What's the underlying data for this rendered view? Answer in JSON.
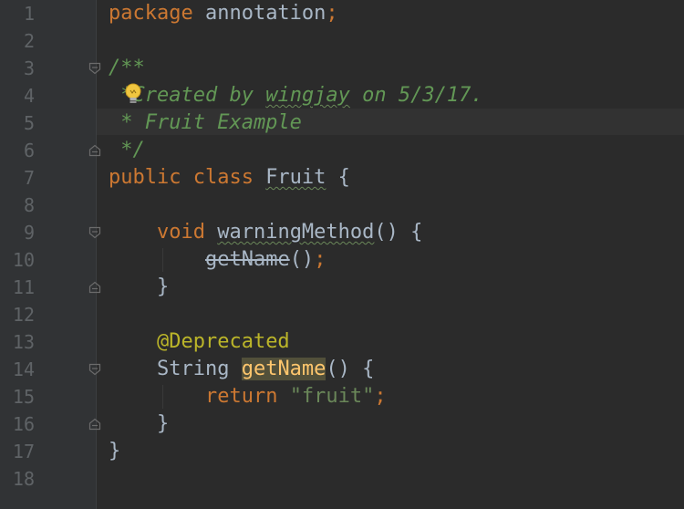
{
  "editor": {
    "line_numbers": [
      "1",
      "2",
      "3",
      "4",
      "5",
      "6",
      "7",
      "8",
      "9",
      "10",
      "11",
      "12",
      "13",
      "14",
      "15",
      "16",
      "17",
      "18"
    ],
    "line1": {
      "kw": "package",
      "rest": " annotation",
      "semi": ";"
    },
    "line3": {
      "doc": "/**"
    },
    "line4": {
      "star": "*",
      "pre": "Created by ",
      "author": "wingjay",
      "post": " on 5/3/17."
    },
    "line5": {
      "doc": " * Fruit Example"
    },
    "line6": {
      "doc": " */"
    },
    "line7": {
      "kw": "public class ",
      "classname": "Fruit",
      "rest": " {"
    },
    "line9": {
      "indent": "    ",
      "kw": "void ",
      "method": "warningMethod",
      "rest": "() {"
    },
    "line10": {
      "indent": "        ",
      "call": "getName",
      "parens": "()",
      "semi": ";"
    },
    "line11": {
      "code": "    }"
    },
    "line13": {
      "indent": "    ",
      "annotation": "@Deprecated"
    },
    "line14": {
      "indent": "    ",
      "type": "String ",
      "method": "getName",
      "rest": "() {"
    },
    "line15": {
      "indent": "        ",
      "kw": "return ",
      "str": "\"fruit\"",
      "semi": ";"
    },
    "line16": {
      "code": "    }"
    },
    "line17": {
      "code": "}"
    }
  }
}
